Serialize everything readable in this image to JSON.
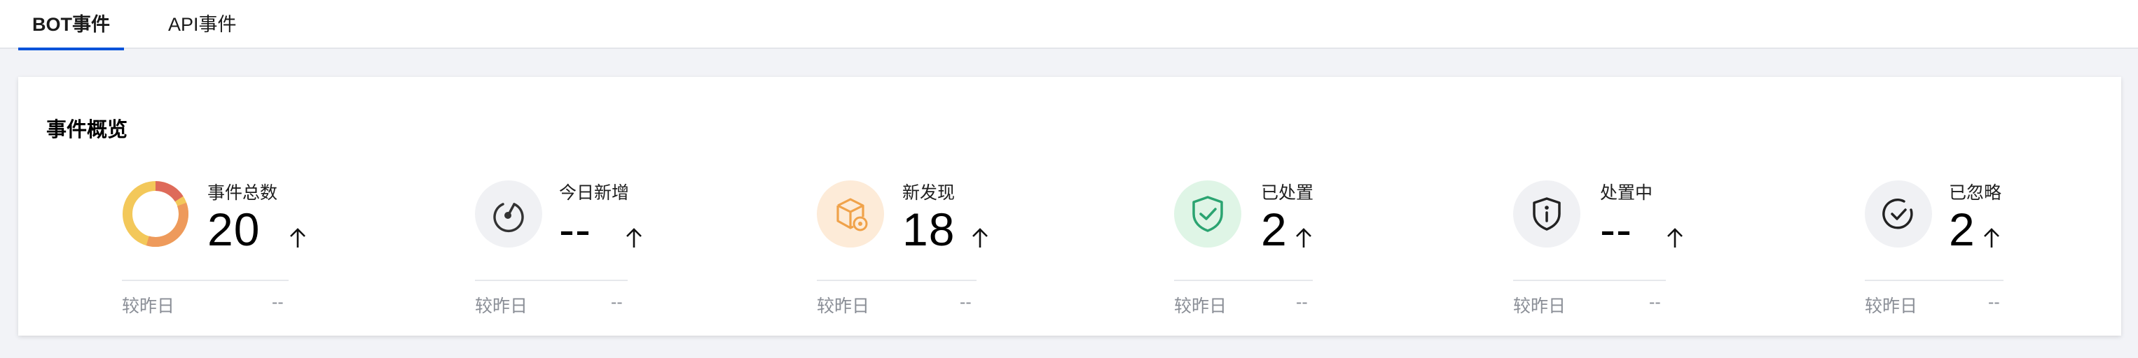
{
  "tabs": [
    {
      "label": "BOT事件",
      "active": true
    },
    {
      "label": "API事件",
      "active": false
    }
  ],
  "overview": {
    "title": "事件概览",
    "stats": [
      {
        "label": "事件总数",
        "value": "20",
        "compare_label": "较昨日",
        "compare_value": "--",
        "icon": "donut-chart-icon"
      },
      {
        "label": "今日新增",
        "value": "--",
        "compare_label": "较昨日",
        "compare_value": "--",
        "icon": "gauge-icon"
      },
      {
        "label": "新发现",
        "value": "18",
        "compare_label": "较昨日",
        "compare_value": "--",
        "icon": "new-box-icon"
      },
      {
        "label": "已处置",
        "value": "2",
        "compare_label": "较昨日",
        "compare_value": "--",
        "icon": "shield-check-icon"
      },
      {
        "label": "处置中",
        "value": "--",
        "compare_label": "较昨日",
        "compare_value": "--",
        "icon": "shield-info-icon"
      },
      {
        "label": "已忽略",
        "value": "2",
        "compare_label": "较昨日",
        "compare_value": "--",
        "icon": "circle-check-icon"
      }
    ]
  },
  "colors": {
    "accent": "#0052d9",
    "orange": "#f0a24a",
    "green": "#2ba471",
    "muted": "#8a8e96"
  }
}
